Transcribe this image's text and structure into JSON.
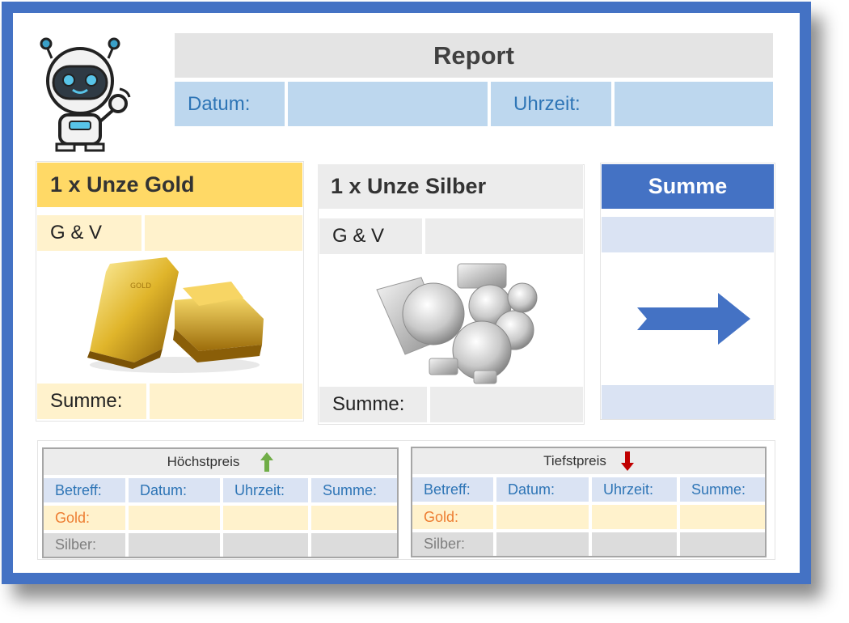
{
  "report": {
    "title": "Report",
    "datum_label": "Datum:",
    "datum_value": "",
    "uhrzeit_label": "Uhrzeit:",
    "uhrzeit_value": ""
  },
  "gold": {
    "title": "1 x Unze Gold",
    "gv_label": "G & V",
    "gv_value": "",
    "summe_label": "Summe:",
    "summe_value": ""
  },
  "silver": {
    "title": "1 x Unze Silber",
    "gv_label": "G & V",
    "gv_value": "",
    "summe_label": "Summe:",
    "summe_value": ""
  },
  "total": {
    "title": "Summe",
    "top_value": "",
    "bottom_value": "",
    "arrow_icon": "right-arrow-icon"
  },
  "high_table": {
    "title": "Höchstpreis",
    "arrow_icon": "up-arrow-icon",
    "arrow_color": "#70ad47",
    "headers": [
      "Betreff:",
      "Datum:",
      "Uhrzeit:",
      "Summe:"
    ],
    "rows": [
      {
        "label": "Gold:",
        "datum": "",
        "uhrzeit": "",
        "summe": ""
      },
      {
        "label": "Silber:",
        "datum": "",
        "uhrzeit": "",
        "summe": ""
      }
    ]
  },
  "low_table": {
    "title": "Tiefstpreis",
    "arrow_icon": "down-arrow-icon",
    "arrow_color": "#c00000",
    "headers": [
      "Betreff:",
      "Datum:",
      "Uhrzeit:",
      "Summe:"
    ],
    "rows": [
      {
        "label": "Gold:",
        "datum": "",
        "uhrzeit": "",
        "summe": ""
      },
      {
        "label": "Silber:",
        "datum": "",
        "uhrzeit": "",
        "summe": ""
      }
    ]
  },
  "colors": {
    "frame": "#4472c4",
    "gold_header": "#ffd966",
    "gold_cell": "#fff2cc",
    "blue_cell": "#bdd7ee",
    "label_blue": "#2e75b6",
    "gold_label": "#ed7d31"
  }
}
